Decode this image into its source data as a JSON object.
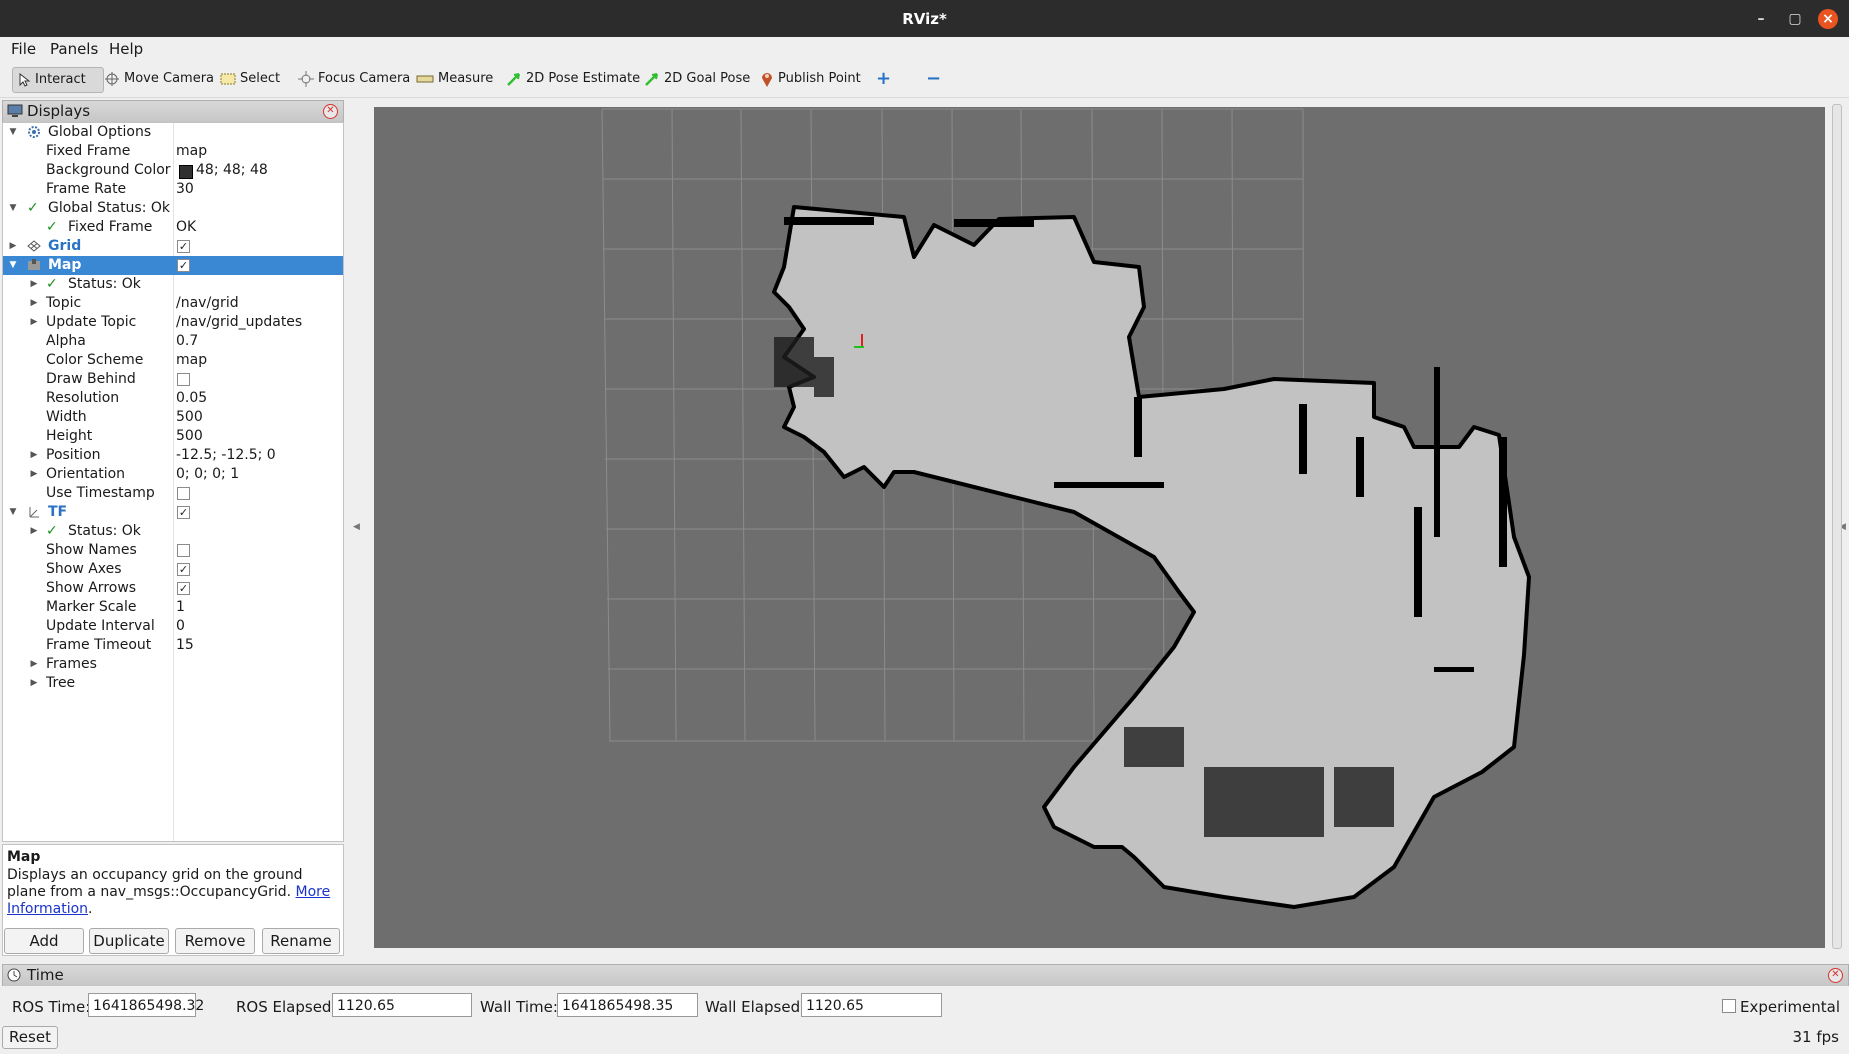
{
  "window": {
    "title": "RViz*",
    "controls": [
      "–",
      "▢",
      "×"
    ]
  },
  "menubar": {
    "file": "File",
    "panels": "Panels",
    "help": "Help"
  },
  "toolbar": {
    "interact": "Interact",
    "move_camera": "Move Camera",
    "select": "Select",
    "focus_camera": "Focus Camera",
    "measure": "Measure",
    "pose_estimate": "2D Pose Estimate",
    "goal_pose": "2D Goal Pose",
    "publish_point": "Publish Point",
    "add_tool": "+",
    "remove_tool": "−"
  },
  "displays_panel": {
    "title": "Displays",
    "rows": [
      {
        "name": "Global Options",
        "value": ""
      },
      {
        "name": "Fixed Frame",
        "value": "map"
      },
      {
        "name": "Background Color",
        "value": "48; 48; 48"
      },
      {
        "name": "Frame Rate",
        "value": "30"
      },
      {
        "name": "Global Status: Ok",
        "value": ""
      },
      {
        "name": "Fixed Frame",
        "value": "OK"
      },
      {
        "name": "Grid",
        "value": ""
      },
      {
        "name": "Map",
        "value": ""
      },
      {
        "name": "Status: Ok",
        "value": ""
      },
      {
        "name": "Topic",
        "value": "/nav/grid"
      },
      {
        "name": "Update Topic",
        "value": "/nav/grid_updates"
      },
      {
        "name": "Alpha",
        "value": "0.7"
      },
      {
        "name": "Color Scheme",
        "value": "map"
      },
      {
        "name": "Draw Behind",
        "value": ""
      },
      {
        "name": "Resolution",
        "value": "0.05"
      },
      {
        "name": "Width",
        "value": "500"
      },
      {
        "name": "Height",
        "value": "500"
      },
      {
        "name": "Position",
        "value": "-12.5; -12.5; 0"
      },
      {
        "name": "Orientation",
        "value": "0; 0; 0; 1"
      },
      {
        "name": "Use Timestamp",
        "value": ""
      },
      {
        "name": "TF",
        "value": ""
      },
      {
        "name": "Status: Ok",
        "value": ""
      },
      {
        "name": "Show Names",
        "value": ""
      },
      {
        "name": "Show Axes",
        "value": ""
      },
      {
        "name": "Show Arrows",
        "value": ""
      },
      {
        "name": "Marker Scale",
        "value": "1"
      },
      {
        "name": "Update Interval",
        "value": "0"
      },
      {
        "name": "Frame Timeout",
        "value": "15"
      },
      {
        "name": "Frames",
        "value": ""
      },
      {
        "name": "Tree",
        "value": ""
      }
    ],
    "checkbox_states": {
      "grid": true,
      "map": true,
      "draw_behind": false,
      "use_timestamp": false,
      "tf": true,
      "show_names": false,
      "show_axes": true,
      "show_arrows": true
    },
    "background_swatch": "#303030"
  },
  "description": {
    "title": "Map",
    "text": "Displays an occupancy grid on the ground plane from a nav_msgs::OccupancyGrid.",
    "link": "More Information",
    "period": "."
  },
  "panel_buttons": {
    "add": "Add",
    "duplicate": "Duplicate",
    "remove": "Remove",
    "rename": "Rename"
  },
  "time_panel": {
    "title": "Time",
    "ros_time_label": "ROS Time:",
    "ros_time": "1641865498.32",
    "ros_elapsed_label": "ROS Elapsed:",
    "ros_elapsed": "1120.65",
    "wall_time_label": "Wall Time:",
    "wall_time": "1641865498.35",
    "wall_elapsed_label": "Wall Elapsed:",
    "wall_elapsed": "1120.65",
    "experimental_label": "Experimental",
    "reset": "Reset",
    "fps": "31 fps"
  },
  "colors": {
    "selection": "#3a88d4",
    "viewport_bg": "#303030",
    "free_space": "#c2c2c2",
    "unknown": "#6e6e6e",
    "occupied": "#000000"
  }
}
